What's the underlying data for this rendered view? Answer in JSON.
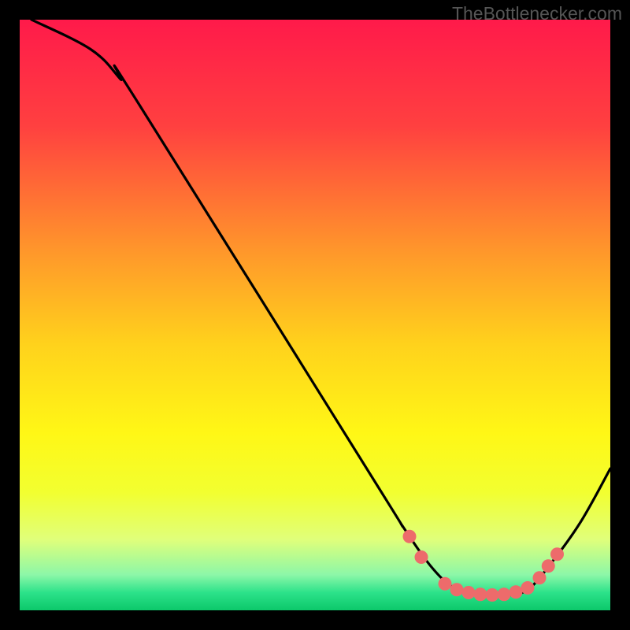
{
  "watermark": "TheBottlenecker.com",
  "chart_data": {
    "type": "line",
    "title": "",
    "xlabel": "",
    "ylabel": "",
    "xlim": [
      0,
      100
    ],
    "ylim": [
      0,
      100
    ],
    "gradient_stops": [
      {
        "offset": 0,
        "color": "#ff1a4a"
      },
      {
        "offset": 18,
        "color": "#ff4040"
      },
      {
        "offset": 40,
        "color": "#ff9a2a"
      },
      {
        "offset": 55,
        "color": "#ffd21c"
      },
      {
        "offset": 70,
        "color": "#fff716"
      },
      {
        "offset": 80,
        "color": "#f2ff30"
      },
      {
        "offset": 88,
        "color": "#e0ff7a"
      },
      {
        "offset": 94,
        "color": "#8cf7a8"
      },
      {
        "offset": 97,
        "color": "#2ce28a"
      },
      {
        "offset": 100,
        "color": "#0cc86a"
      }
    ],
    "curve": [
      {
        "x": 2,
        "y": 100
      },
      {
        "x": 12,
        "y": 95
      },
      {
        "x": 17,
        "y": 90
      },
      {
        "x": 20,
        "y": 86
      },
      {
        "x": 60,
        "y": 22
      },
      {
        "x": 65,
        "y": 14
      },
      {
        "x": 70,
        "y": 7
      },
      {
        "x": 74,
        "y": 3.5
      },
      {
        "x": 78,
        "y": 2.5
      },
      {
        "x": 82,
        "y": 2.5
      },
      {
        "x": 86,
        "y": 3.5
      },
      {
        "x": 90,
        "y": 8
      },
      {
        "x": 95,
        "y": 15
      },
      {
        "x": 100,
        "y": 24
      }
    ],
    "markers": [
      {
        "x": 66,
        "y": 12.5
      },
      {
        "x": 68,
        "y": 9
      },
      {
        "x": 72,
        "y": 4.5
      },
      {
        "x": 74,
        "y": 3.5
      },
      {
        "x": 76,
        "y": 3
      },
      {
        "x": 78,
        "y": 2.7
      },
      {
        "x": 80,
        "y": 2.6
      },
      {
        "x": 82,
        "y": 2.7
      },
      {
        "x": 84,
        "y": 3.1
      },
      {
        "x": 86,
        "y": 3.8
      },
      {
        "x": 88,
        "y": 5.5
      },
      {
        "x": 89.5,
        "y": 7.5
      },
      {
        "x": 91,
        "y": 9.5
      }
    ]
  }
}
